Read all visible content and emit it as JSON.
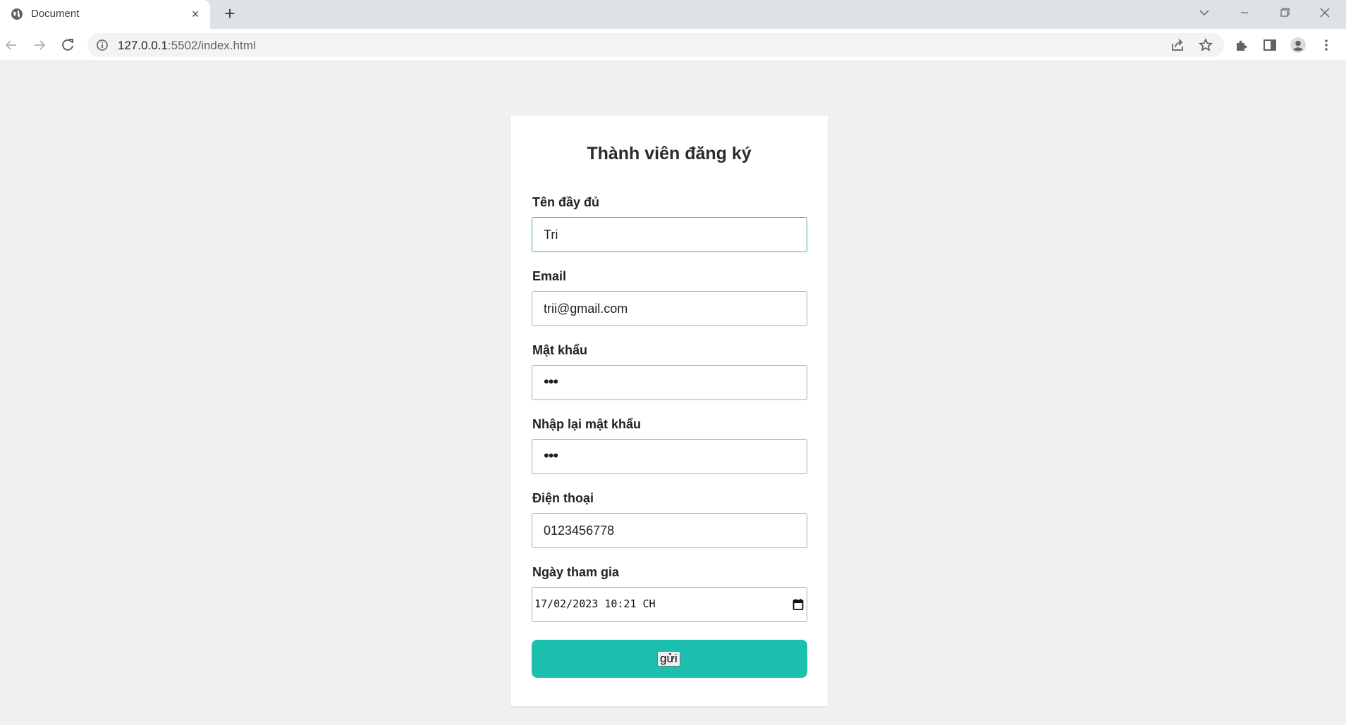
{
  "browser": {
    "tab_title": "Document",
    "tab_close": "×",
    "new_tab": "+",
    "url_host": "127.0.0.1",
    "url_rest": ":5502/index.html",
    "icons": [
      "globe-icon",
      "back-icon",
      "forward-icon",
      "reload-icon",
      "info-icon",
      "share-icon",
      "star-icon",
      "extensions-icon",
      "side-panel-icon",
      "profile-icon",
      "menu-icon",
      "minimize-icon",
      "restore-icon",
      "close-window-icon",
      "tab-search-icon"
    ]
  },
  "form": {
    "title": "Thành viên đăng ký",
    "fields": [
      {
        "label": "Tên đầy đủ",
        "value": "Tri"
      },
      {
        "label": "Email",
        "value": "trii@gmail.com"
      },
      {
        "label": "Mật khẩu",
        "value": "•••"
      },
      {
        "label": "Nhập lại mật khẩu",
        "value": "•••"
      },
      {
        "label": "Điện thoại",
        "value": "0123456778"
      },
      {
        "label": "Ngày tham gia",
        "value": "17/02/2023 10:21 CH"
      }
    ],
    "submit_label": "gửi",
    "accent_color": "#1bbfad",
    "focus_color": "#2bb5a5"
  }
}
